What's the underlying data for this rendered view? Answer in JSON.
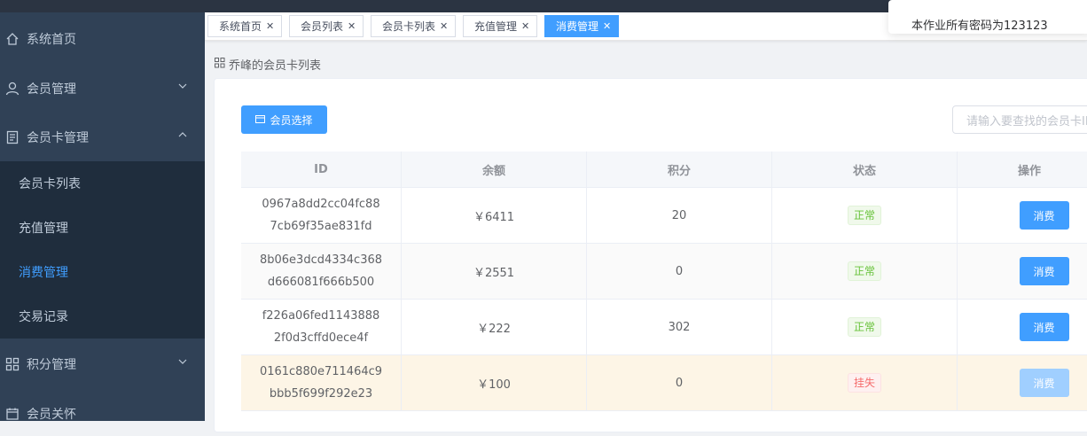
{
  "notice": "本作业所有密码为123123",
  "sidebar": {
    "items": [
      {
        "label": "系统首页",
        "icon": "home-icon"
      },
      {
        "label": "会员管理",
        "icon": "user-icon"
      },
      {
        "label": "会员卡管理",
        "icon": "document-icon"
      },
      {
        "label": "积分管理",
        "icon": "grid-icon"
      },
      {
        "label": "会员关怀",
        "icon": "calendar-icon"
      }
    ],
    "sub_items": [
      {
        "label": "会员卡列表"
      },
      {
        "label": "充值管理"
      },
      {
        "label": "消费管理",
        "active": true
      },
      {
        "label": "交易记录"
      }
    ]
  },
  "tabs": [
    {
      "label": "系统首页"
    },
    {
      "label": "会员列表"
    },
    {
      "label": "会员卡列表"
    },
    {
      "label": "充值管理"
    },
    {
      "label": "消费管理",
      "active": true
    }
  ],
  "breadcrumb": "乔峰的会员卡列表",
  "toolbar": {
    "select_member_label": "会员选择",
    "search_placeholder": "请输入要查找的会员卡ID"
  },
  "table": {
    "headers": [
      "ID",
      "余额",
      "积分",
      "状态",
      "操作"
    ],
    "rows": [
      {
        "id": "0967a8dd2cc04fc887cb69f35ae831fd",
        "balance": "￥6411",
        "points": "20",
        "status": "正常",
        "action": "消费"
      },
      {
        "id": "8b06e3dcd4334c368d666081f666b500",
        "balance": "￥2551",
        "points": "0",
        "status": "正常",
        "action": "消费"
      },
      {
        "id": "f226a06fed11438882f0d3cffd0ece4f",
        "balance": "￥222",
        "points": "302",
        "status": "正常",
        "action": "消费"
      },
      {
        "id": "0161c880e711464c9bbb5f699f292e23",
        "balance": "￥100",
        "points": "0",
        "status": "挂失",
        "action": "消费"
      }
    ]
  },
  "colors": {
    "sidebar_bg": "#304156",
    "accent": "#409eff",
    "active_menu": "#409eff",
    "status_ok": "#67c23a",
    "status_lost": "#f56c6c",
    "highlight_row": "#fdf5e6"
  }
}
